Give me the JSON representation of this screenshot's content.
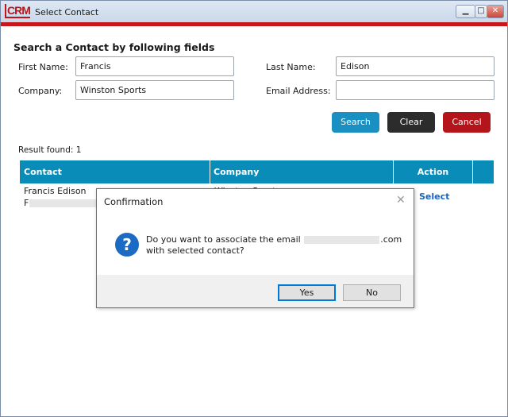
{
  "window": {
    "logo_text": "CRM",
    "title": "Select Contact",
    "minimize_glyph": "▁",
    "maximize_glyph": "□",
    "close_glyph": "✕"
  },
  "search": {
    "section_title": "Search a Contact by following fields",
    "first_name_label": "First Name:",
    "first_name_value": "Francis",
    "last_name_label": "Last Name:",
    "last_name_value": "Edison",
    "company_label": "Company:",
    "company_value": "Winston Sports",
    "email_label": "Email Address:",
    "email_value": ""
  },
  "buttons": {
    "search": "Search",
    "clear": "Clear",
    "cancel": "Cancel"
  },
  "results": {
    "count_text": "Result found: 1",
    "columns": [
      "Contact",
      "Company",
      "Action"
    ],
    "rows": [
      {
        "contact": "Francis Edison",
        "contact_line2_prefix": "F",
        "company": "Winston Sports",
        "action": "Select"
      }
    ]
  },
  "dialog": {
    "title": "Confirmation",
    "close_glyph": "✕",
    "icon_glyph": "?",
    "message_prefix": "Do you want to associate the email",
    "message_suffix": ".com",
    "message_line2": "with selected contact?",
    "yes_label": "Yes",
    "no_label": "No"
  },
  "colors": {
    "brand_red": "#c8161d",
    "header_blue": "#0a8cb9",
    "search_button": "#1a90c2",
    "clear_button": "#2c2c2c",
    "cancel_button": "#b3151b",
    "link_blue": "#1565c0",
    "question_icon": "#1b6bc4"
  },
  "icons": {
    "window_logo": "crm-logo-icon",
    "dialog_icon": "question-icon"
  }
}
